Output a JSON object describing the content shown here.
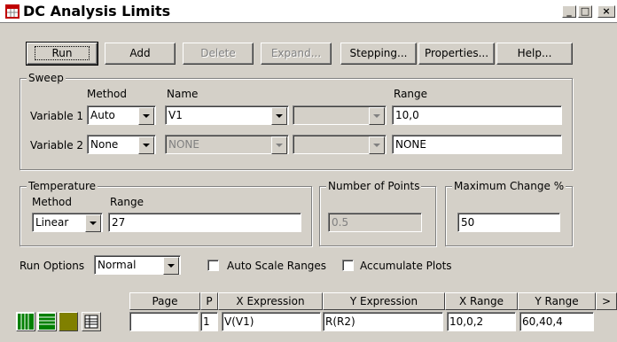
{
  "window": {
    "title": "DC Analysis Limits",
    "controls": {
      "minimize": "_",
      "maximize": "□",
      "close": "×"
    }
  },
  "toolbar": {
    "run": "Run",
    "add": "Add",
    "delete": "Delete",
    "expand": "Expand...",
    "stepping": "Stepping...",
    "properties": "Properties...",
    "help": "Help..."
  },
  "sweep": {
    "label": "Sweep",
    "method_header": "Method",
    "name_header": "Name",
    "range_header": "Range",
    "var1": {
      "label": "Variable 1",
      "method": "Auto",
      "name": "V1",
      "name2": "",
      "range": "10,0"
    },
    "var2": {
      "label": "Variable 2",
      "method": "None",
      "name": "NONE",
      "name2": "",
      "range": "NONE"
    }
  },
  "temperature": {
    "label": "Temperature",
    "method_header": "Method",
    "range_header": "Range",
    "method": "Linear",
    "range": "27"
  },
  "points": {
    "label": "Number of Points",
    "value": "0.5"
  },
  "maxchange": {
    "label": "Maximum Change %",
    "value": "50"
  },
  "options": {
    "run_options_label": "Run Options",
    "run_options_value": "Normal",
    "auto_scale": "Auto Scale Ranges",
    "accumulate": "Accumulate Plots"
  },
  "grid": {
    "headers": {
      "page": "Page",
      "p": "P",
      "x_expr": "X Expression",
      "y_expr": "Y Expression",
      "x_range": "X Range",
      "y_range": "Y Range",
      "more": ">"
    },
    "row": {
      "page": "",
      "p": "1",
      "x_expr": "V(V1)",
      "y_expr": "R(R2)",
      "x_range": "10,0,2",
      "y_range": "60,40,4"
    },
    "plot_color": "#808000"
  },
  "colors": {
    "accent_green": "#008000",
    "olive": "#808000"
  }
}
